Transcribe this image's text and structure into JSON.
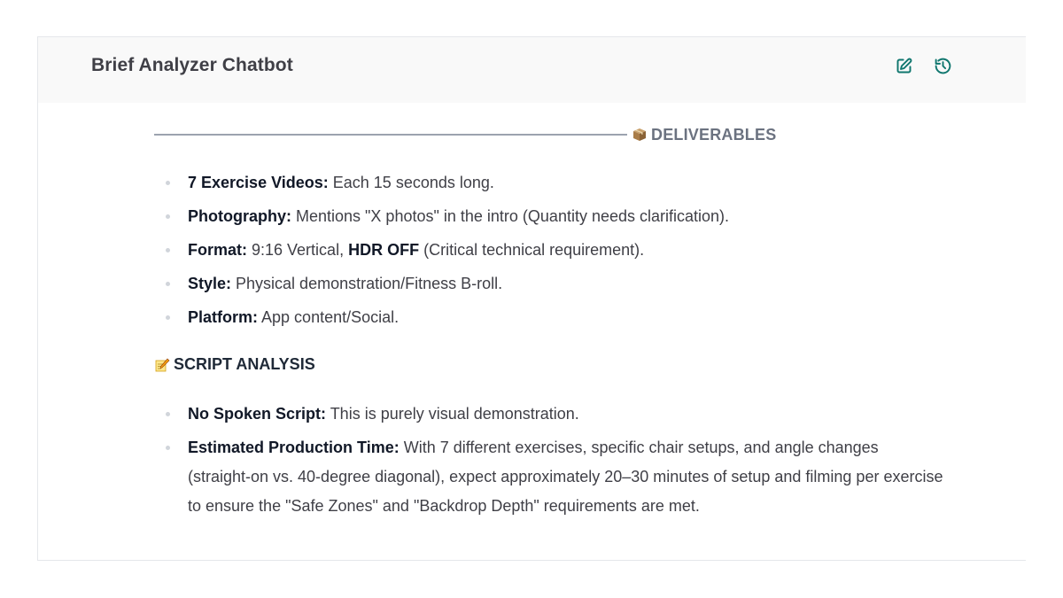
{
  "header": {
    "title": "Brief Analyzer Chatbot",
    "edit_icon": "edit-icon",
    "history_icon": "history-icon"
  },
  "deliverables": {
    "emoji": "package-icon",
    "label": "DELIVERABLES",
    "items": [
      {
        "label": "7 Exercise Videos:",
        "text": " Each 15 seconds long."
      },
      {
        "label": "Photography:",
        "text": " Mentions \"X photos\" in the intro (Quantity needs clarification)."
      },
      {
        "label": "Format:",
        "text_before": " 9:16 Vertical, ",
        "emphasis": "HDR OFF",
        "text_after": " (Critical technical requirement)."
      },
      {
        "label": "Style:",
        "text": " Physical demonstration/Fitness B-roll."
      },
      {
        "label": "Platform:",
        "text": " App content/Social."
      }
    ]
  },
  "script_analysis": {
    "emoji": "memo-icon",
    "label": "SCRIPT ANALYSIS",
    "items": [
      {
        "label": "No Spoken Script:",
        "text": " This is purely visual demonstration."
      },
      {
        "label": "Estimated Production Time:",
        "text": " With 7 different exercises, specific chair setups, and angle changes (straight-on vs. 40-degree diagonal), expect approximately 20–30 minutes of setup and filming per exercise to ensure the \"Safe Zones\" and \"Backdrop Depth\" requirements are met."
      }
    ]
  },
  "colors": {
    "accent": "#0f766e",
    "header_bg": "#f9f9f9"
  }
}
